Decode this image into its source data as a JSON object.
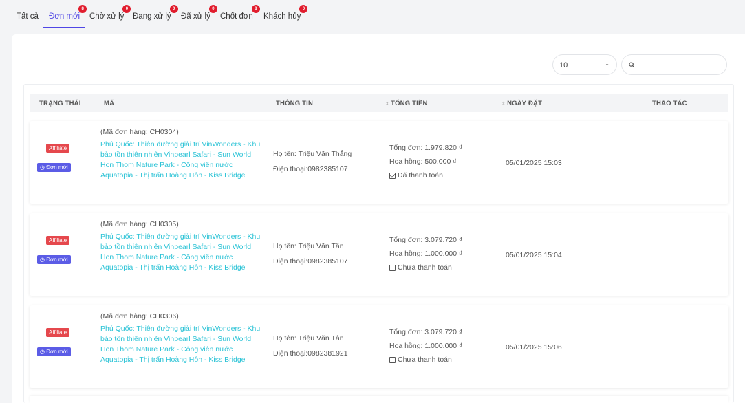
{
  "tabs": [
    {
      "label": "Tất cả",
      "badge": ""
    },
    {
      "label": "Đơn mới",
      "badge": "8"
    },
    {
      "label": "Chờ xử lý",
      "badge": "0"
    },
    {
      "label": "Đang xử lý",
      "badge": "0"
    },
    {
      "label": "Đã xử lý",
      "badge": "0"
    },
    {
      "label": "Chốt đơn",
      "badge": "8"
    },
    {
      "label": "Khách hủy",
      "badge": "0"
    }
  ],
  "toolbar": {
    "page_size": "10",
    "search_placeholder": ""
  },
  "table": {
    "headers": {
      "status": "TRẠNG THÁI",
      "code": "MÃ",
      "info": "THÔNG TIN",
      "total": "TỔNG TIỀN",
      "date": "NGÀY ĐẶT",
      "actions": "THAO TÁC"
    },
    "rows": [
      {
        "source_badge": "Affiliate",
        "status_badge": "Đơn mới",
        "order_code": "(Mã đơn hàng: CH0304)",
        "product": "Phú Quốc: Thiên đường giải trí VinWonders - Khu bảo tồn thiên nhiên Vinpearl Safari - Sun World Hon Thom Nature Park - Công viên nước Aquatopia - Thị trấn Hoàng Hôn - Kiss Bridge",
        "name": "Họ tên: Triệu Văn Thắng",
        "phone": "Điện thoại:0982385107",
        "total": "Tổng đơn: 1.979.820 ₫",
        "commission": "Hoa hồng: 500.000 ₫",
        "payment": "Đã thanh toán",
        "paid": true,
        "date": "05/01/2025 15:03"
      },
      {
        "source_badge": "Affiliate",
        "status_badge": "Đơn mới",
        "order_code": "(Mã đơn hàng: CH0305)",
        "product": "Phú Quốc: Thiên đường giải trí VinWonders - Khu bảo tồn thiên nhiên Vinpearl Safari - Sun World Hon Thom Nature Park - Công viên nước Aquatopia - Thị trấn Hoàng Hôn - Kiss Bridge",
        "name": "Họ tên: Triệu Văn Tân",
        "phone": "Điện thoại:0982385107",
        "total": "Tổng đơn: 3.079.720 ₫",
        "commission": "Hoa hồng: 1.000.000 ₫",
        "payment": "Chưa thanh toán",
        "paid": false,
        "date": "05/01/2025 15:04"
      },
      {
        "source_badge": "Affiliate",
        "status_badge": "Đơn mới",
        "order_code": "(Mã đơn hàng: CH0306)",
        "product": "Phú Quốc: Thiên đường giải trí VinWonders - Khu bảo tồn thiên nhiên Vinpearl Safari - Sun World Hon Thom Nature Park - Công viên nước Aquatopia - Thị trấn Hoàng Hôn - Kiss Bridge",
        "name": "Họ tên: Triệu Văn Tân",
        "phone": "Điện thoại:0982381921",
        "total": "Tổng đơn: 3.079.720 ₫",
        "commission": "Hoa hồng: 1.000.000 ₫",
        "payment": "Chưa thanh toán",
        "paid": false,
        "date": "05/01/2025 15:06"
      }
    ]
  }
}
